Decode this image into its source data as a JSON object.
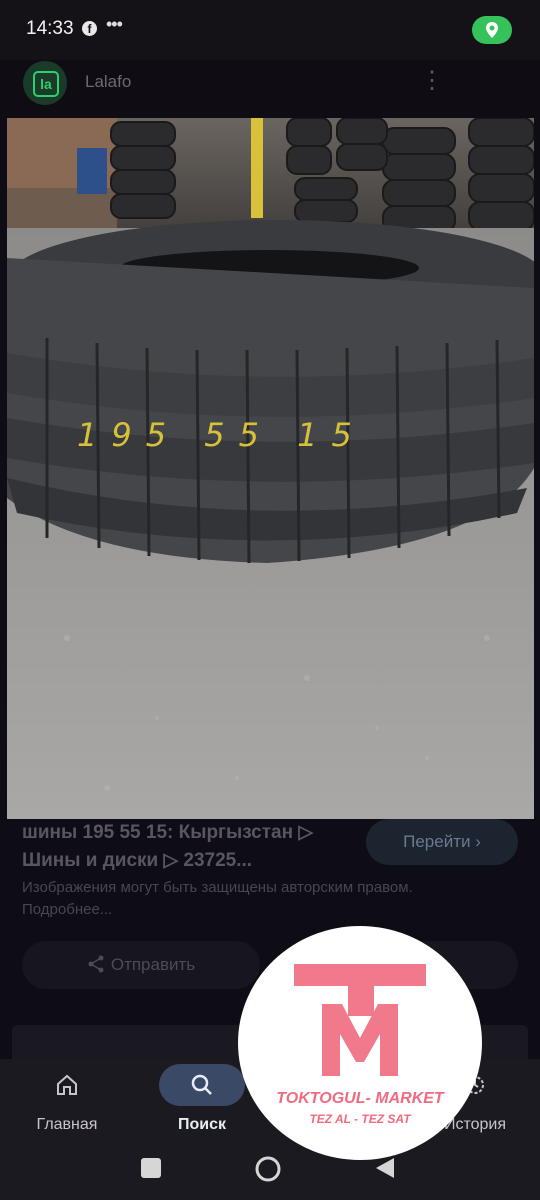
{
  "status_bar": {
    "time": "14:33"
  },
  "source": {
    "name": "Lalafo",
    "logo_text": "la"
  },
  "result": {
    "title": "шины 195 55 15: Кыргызстан ▷ Шины и диски ▷ 23725...",
    "go_label": "Перейти ›",
    "copyright": "Изображения могут быть защищены авторским правом. Подробнее...",
    "share_label": "Отправить"
  },
  "tire_marking": "195 55 15",
  "bottom_nav": {
    "home_label": "Главная",
    "search_label": "Поиск",
    "history_label": "История"
  },
  "watermark": {
    "line1": "TOKTOGUL- MARKET",
    "line2": "TEZ AL - TEZ SAT"
  },
  "colors": {
    "accent_green": "#36c25a",
    "nav_pill": "#3a4a66",
    "watermark_pink": "#f06a80"
  }
}
